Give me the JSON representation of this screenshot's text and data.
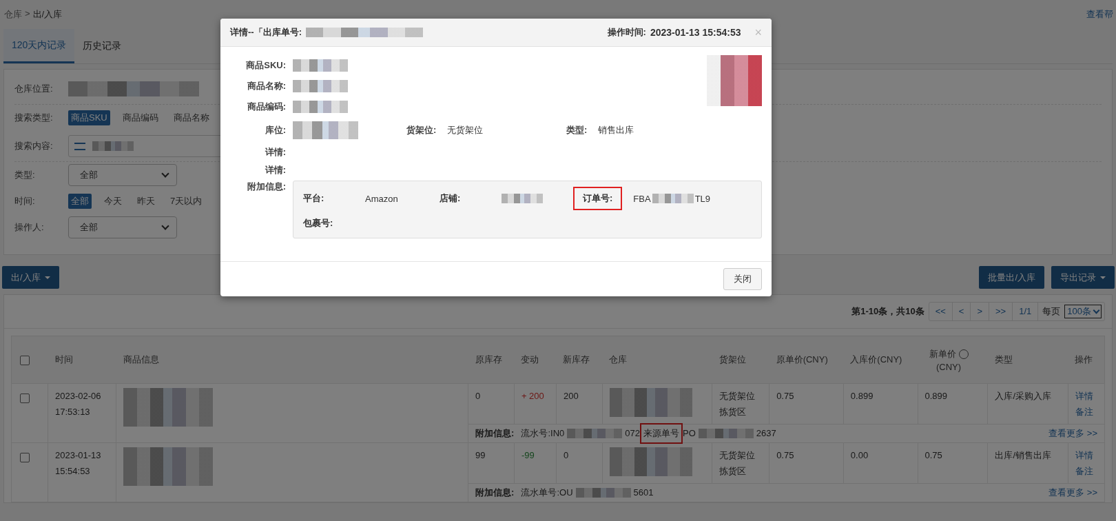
{
  "breadcrumb": {
    "items": [
      "仓库",
      "出/入库"
    ],
    "separator": ">"
  },
  "help_link": "查看帮",
  "tabs": [
    {
      "label": "120天内记录",
      "selected": true
    },
    {
      "label": "历史记录",
      "selected": false
    }
  ],
  "filters": {
    "warehouse": {
      "label": "仓库位置:",
      "redacted": true
    },
    "search_type": {
      "label": "搜索类型:",
      "options": [
        {
          "label": "商品SKU",
          "selected": true
        },
        {
          "label": "商品编码",
          "selected": false
        },
        {
          "label": "商品名称",
          "selected": false
        }
      ]
    },
    "search_content": {
      "label": "搜索内容:",
      "redacted": true
    },
    "type": {
      "label": "类型:",
      "value": "全部"
    },
    "time": {
      "label": "时间:",
      "options": [
        {
          "label": "全部",
          "selected": true
        },
        {
          "label": "今天",
          "selected": false
        },
        {
          "label": "昨天",
          "selected": false
        },
        {
          "label": "7天以内",
          "selected": false
        }
      ]
    },
    "operator": {
      "label": "操作人:",
      "value": "全部"
    }
  },
  "actions": {
    "left": [
      {
        "label": "出/入库",
        "dropdown": true
      }
    ],
    "right": [
      {
        "label": "批量出/入库",
        "dropdown": false
      },
      {
        "label": "导出记录",
        "dropdown": true
      }
    ]
  },
  "pagination": {
    "summary": "第1-10条，共10条",
    "buttons": [
      "<<",
      "<",
      ">",
      ">>",
      "1/1"
    ],
    "per_page_label": "每页",
    "per_page": "100条"
  },
  "table": {
    "select_all_checked": false,
    "columns": [
      {
        "label": "时间"
      },
      {
        "label": "商品信息"
      },
      {
        "label": "原库存"
      },
      {
        "label": "变动"
      },
      {
        "label": "新库存"
      },
      {
        "label": "仓库"
      },
      {
        "label": "货架位"
      },
      {
        "label": "原单价(CNY)"
      },
      {
        "label": "入库价(CNY)"
      },
      {
        "label": "新单价",
        "sub": "(CNY)",
        "help": true
      },
      {
        "label": "类型"
      },
      {
        "label": "操作"
      }
    ],
    "rows": [
      {
        "checked": false,
        "time": [
          "2023-02-06",
          "17:53:13"
        ],
        "old_stock": "0",
        "change": {
          "text": "+ 200",
          "kind": "increase"
        },
        "new_stock": "200",
        "shelf": [
          "无货架位",
          "拣货区"
        ],
        "orig_price": "0.75",
        "in_price": "0.899",
        "new_price": "0.899",
        "type": "入库/采购入库",
        "actions": [
          "详情",
          "备注"
        ],
        "extra": {
          "label": "附加信息:",
          "segments": [
            {
              "kind": "text",
              "text": "流水号:IN0"
            },
            {
              "kind": "redacted"
            },
            {
              "kind": "text",
              "text": "072"
            },
            {
              "kind": "text",
              "text": "来源单号",
              "highlighted": true
            },
            {
              "kind": "text",
              "text": "PO"
            },
            {
              "kind": "redacted"
            },
            {
              "kind": "text",
              "text": "2637"
            }
          ],
          "more": "查看更多 >>"
        }
      },
      {
        "checked": false,
        "time": [
          "2023-01-13",
          "15:54:53"
        ],
        "old_stock": "99",
        "change": {
          "text": "-99",
          "kind": "decrease"
        },
        "new_stock": "0",
        "shelf": [
          "无货架位",
          "拣货区"
        ],
        "orig_price": "0.75",
        "in_price": "0.00",
        "new_price": "0.75",
        "type": "出库/销售出库",
        "actions": [
          "详情",
          "备注"
        ],
        "extra": {
          "label": "附加信息:",
          "segments": [
            {
              "kind": "text",
              "text": "流水单号:OU"
            },
            {
              "kind": "redacted"
            },
            {
              "kind": "text",
              "text": "5601"
            }
          ],
          "more": "查看更多 >>"
        }
      }
    ]
  },
  "modal": {
    "title": "详情--「出库单号:",
    "time_label": "操作时间:",
    "time": "2023-01-13 15:54:53",
    "close": "×",
    "fields": [
      {
        "label": "商品SKU:"
      },
      {
        "label": "商品名称:"
      },
      {
        "label": "商品编码:"
      }
    ],
    "location": [
      {
        "label": "库位:",
        "redacted": true
      },
      {
        "label": "货架位:",
        "value": "无货架位"
      },
      {
        "label": "类型:",
        "value": "销售出库"
      }
    ],
    "details": [
      {
        "label": "详情:"
      },
      {
        "label": "详情:"
      }
    ],
    "extra_label": "附加信息:",
    "extra": [
      {
        "label": "平台:",
        "segments": [
          {
            "kind": "text",
            "text": "Amazon"
          }
        ]
      },
      {
        "label": "店铺:",
        "segments": [
          {
            "kind": "redacted"
          }
        ]
      },
      {
        "label": "订单号:",
        "highlighted": true,
        "segments": [
          {
            "kind": "text",
            "text": "FBA"
          },
          {
            "kind": "redacted"
          },
          {
            "kind": "text",
            "text": "TL9"
          }
        ]
      },
      {
        "label": "包裹号:"
      }
    ],
    "footer_button": "关闭"
  }
}
